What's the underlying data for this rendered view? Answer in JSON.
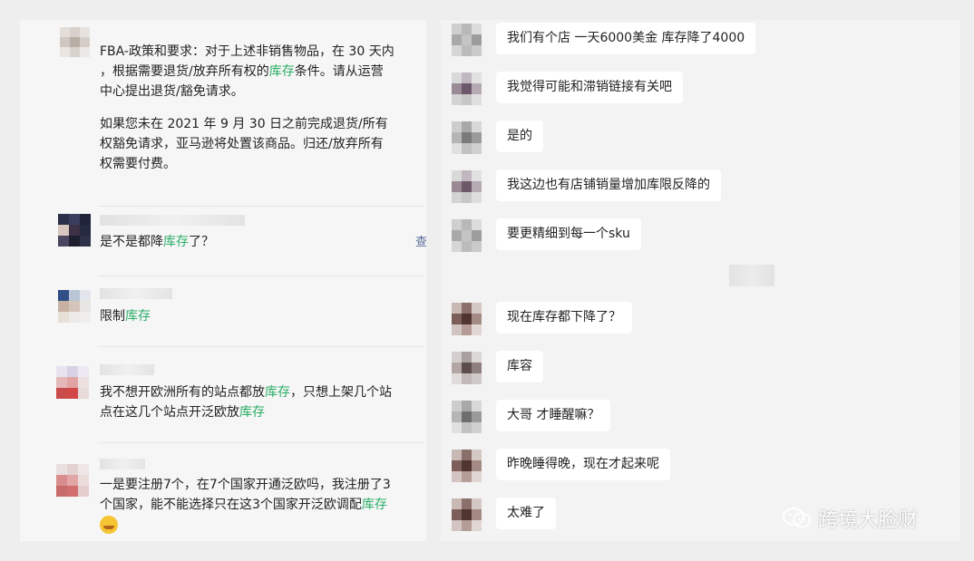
{
  "left_chat": {
    "msg1": {
      "line1": "FBA-政策和要求：对于上述非销售物品，在 30 天内",
      "line2": "，根据需要退货/放弃所有权的",
      "line2_hl": "库存",
      "line2_tail": "条件。请从运营",
      "line3": "中心提出退货/豁免请求。",
      "line4": "如果您未在 2021 年 9 月 30 日之前完成退货/所有",
      "line5": "权豁免请求，亚马逊将处置该商品。归还/放弃所有",
      "line6": "权需要付费。"
    },
    "msg2": {
      "pre": "是不是都降",
      "hl": "库存",
      "post": "了？",
      "side": "查"
    },
    "msg3": {
      "pre": "限制",
      "hl": "库存"
    },
    "msg4": {
      "l1_pre": "我不想开欧洲所有的站点都放",
      "l1_hl": "库存",
      "l1_post": "，只想上架几个站",
      "l2_pre": "点在这几个站点开泛欧放",
      "l2_hl": "库存"
    },
    "msg5": {
      "l1": "一是要注册7个，在7个国家开通泛欧吗，我注册了3",
      "l2_pre": "个国家，能不能选择只在这3个国家开泛欧调配",
      "l2_hl": "库存"
    }
  },
  "right_chat": {
    "messages": [
      "我们有个店  一天6000美金  库存降了4000",
      "我觉得可能和滞销链接有关吧",
      "是的",
      "我这边也有店铺销量增加库限反降的",
      "要更精细到每一个sku",
      "现在库存都下降了？",
      "库容",
      "大哥  才睡醒嘛？",
      "昨晚睡得晚，现在才起来呢",
      "太难了"
    ]
  },
  "watermark": {
    "text": "跨境大脸财"
  },
  "colors": {
    "highlight": "#2aae67",
    "panel_left": "#f6f6f6",
    "panel_right": "#f3f3f3"
  }
}
